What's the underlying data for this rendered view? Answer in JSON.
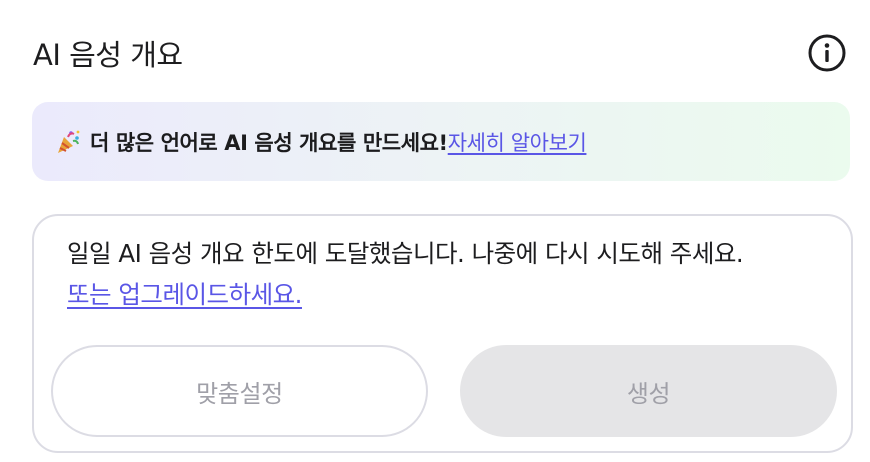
{
  "header": {
    "title": "AI 음성 개요",
    "info_icon": "info-circle-icon"
  },
  "banner": {
    "icon": "party-popper-icon",
    "text": "더 많은 언어로 AI 음성 개요를 만드세요!",
    "link": "자세히 알아보기",
    "gradient": [
      "#ebeafc",
      "#ebfbee"
    ]
  },
  "limit_card": {
    "message": "일일 AI 음성 개요 한도에 도달했습니다. 나중에 다시 시도해 주세요.",
    "upgrade_link": "또는 업그레이드하세요."
  },
  "actions": {
    "customize_label": "맞춤설정",
    "generate_label": "생성"
  },
  "colors": {
    "accent": "#5a56e6",
    "disabled_text": "#a0a0a8",
    "disabled_bg": "#e5e5e7",
    "border": "#dcdce4"
  }
}
